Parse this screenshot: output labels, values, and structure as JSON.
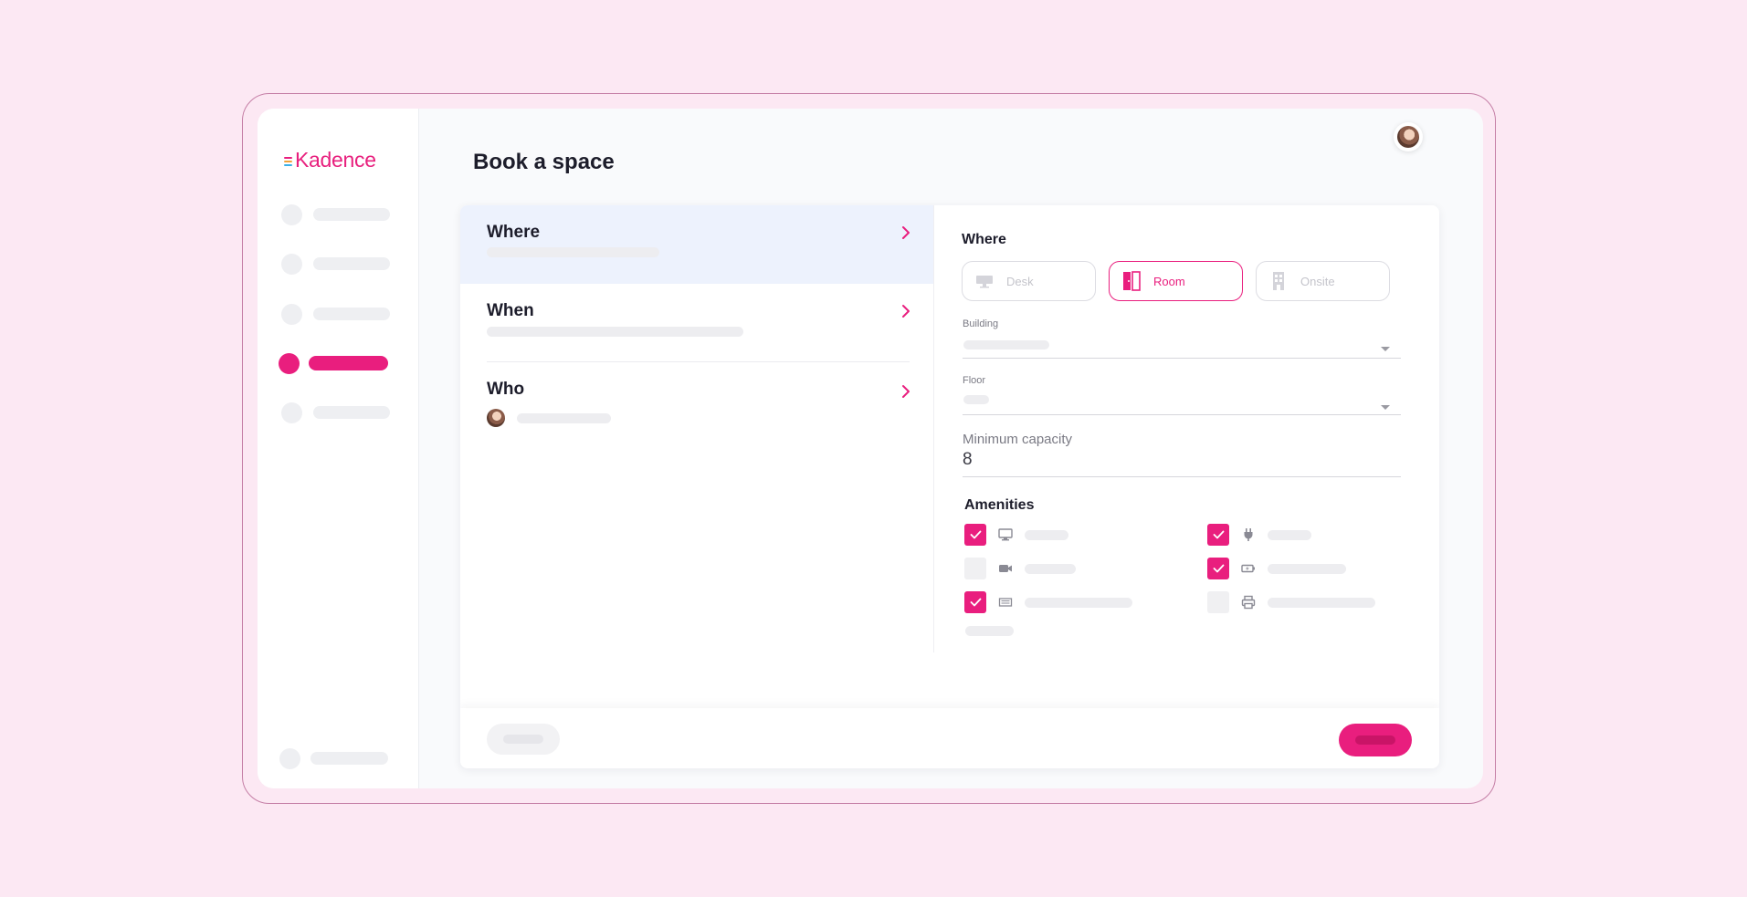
{
  "app": {
    "logo_text": "Kadence",
    "logo_bar_colors": [
      "#e91e7e",
      "#f2a33a",
      "#3ab0e8"
    ],
    "accent_color": "#e91e7e"
  },
  "sidebar": {
    "items": [
      {
        "name": "nav-item-1",
        "active": false
      },
      {
        "name": "nav-item-2",
        "active": false
      },
      {
        "name": "nav-item-3",
        "active": false
      },
      {
        "name": "nav-item-4",
        "active": true
      },
      {
        "name": "nav-item-5",
        "active": false
      }
    ],
    "bottom_item": {
      "name": "nav-item-bottom"
    }
  },
  "page": {
    "title": "Book a space",
    "user_avatar": "avatar-icon"
  },
  "steps": [
    {
      "title": "Where",
      "active": true,
      "icon": "chevron-right-icon"
    },
    {
      "title": "When",
      "active": false,
      "icon": "chevron-right-icon"
    },
    {
      "title": "Who",
      "active": false,
      "icon": "chevron-right-icon"
    }
  ],
  "where_panel": {
    "heading": "Where",
    "space_types": [
      {
        "label": "Desk",
        "icon": "desk-icon",
        "selected": false
      },
      {
        "label": "Room",
        "icon": "door-icon",
        "selected": true
      },
      {
        "label": "Onsite",
        "icon": "building-icon",
        "selected": false
      }
    ],
    "building": {
      "label": "Building",
      "icon": "chevron-down-icon"
    },
    "floor": {
      "label": "Floor",
      "icon": "chevron-down-icon"
    },
    "capacity": {
      "label": "Minimum capacity",
      "value": "8"
    },
    "amenities": {
      "heading": "Amenities",
      "items": [
        {
          "icon": "monitor-icon",
          "checked": true
        },
        {
          "icon": "plug-icon",
          "checked": true
        },
        {
          "icon": "video-camera-icon",
          "checked": false
        },
        {
          "icon": "charging-icon",
          "checked": true
        },
        {
          "icon": "whiteboard-icon",
          "checked": true
        },
        {
          "icon": "printer-icon",
          "checked": false
        }
      ]
    }
  },
  "footer": {
    "back_button": "back-button",
    "next_button": "next-button"
  }
}
